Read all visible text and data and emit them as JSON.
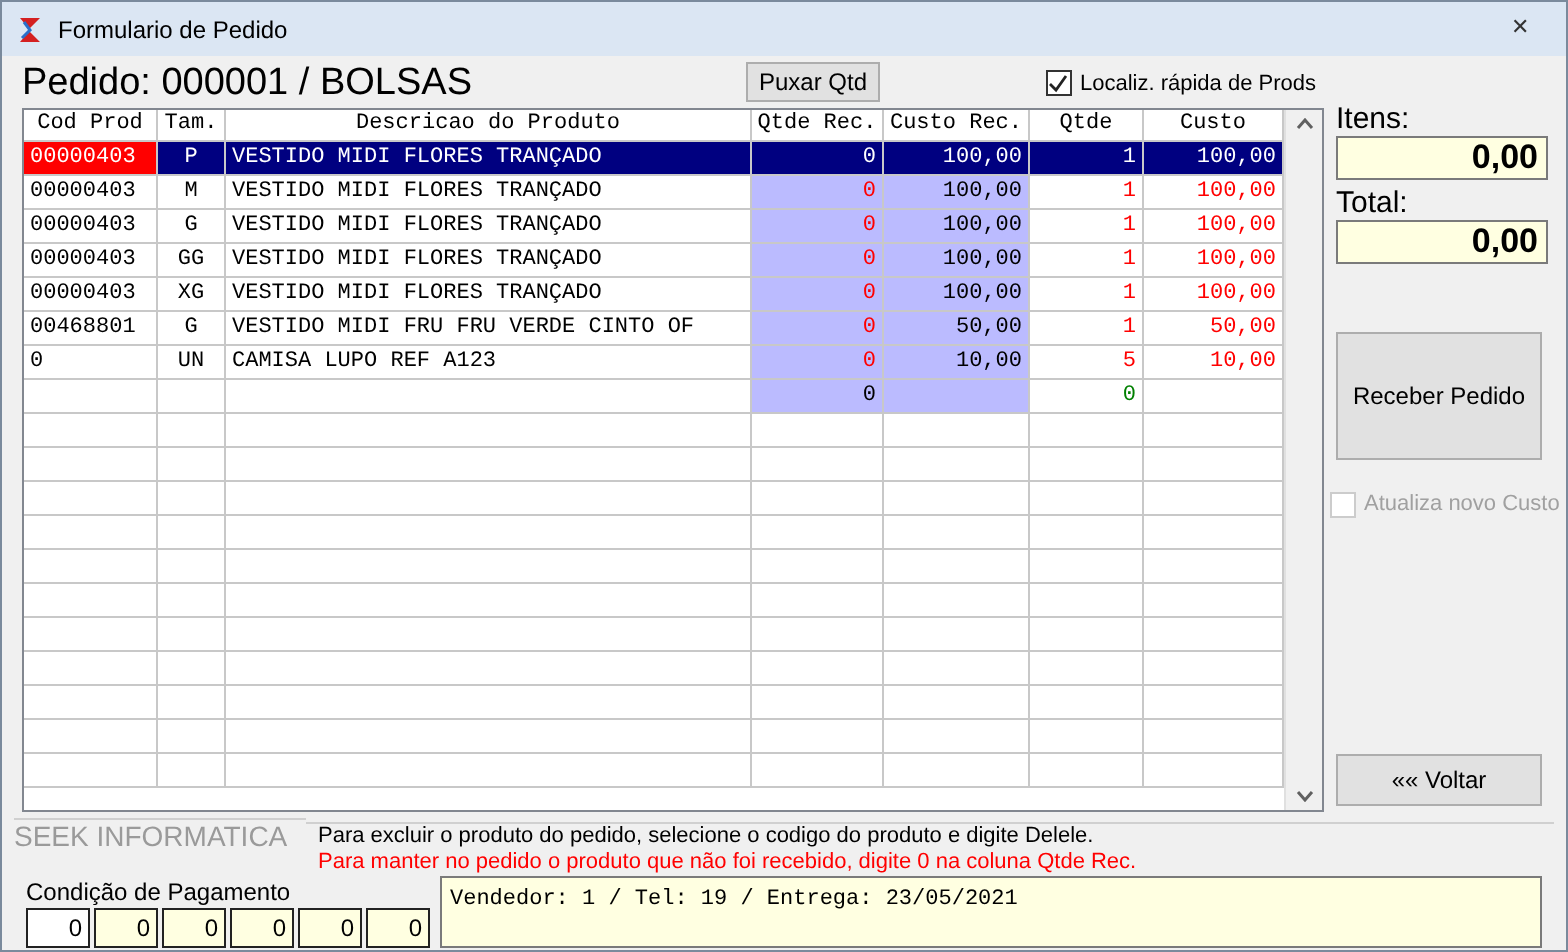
{
  "window": {
    "title": "Formulario de Pedido",
    "close": "✕"
  },
  "header": {
    "title": "Pedido: 000001 / BOLSAS",
    "pull_button": "Puxar Qtd",
    "quick_search": {
      "label": "Localiz. rápida de Prods",
      "checked": true
    }
  },
  "table": {
    "columns": [
      "Cod Prod",
      "Tam.",
      "Descricao do Produto",
      "Qtde Rec.",
      "Custo Rec.",
      "Qtde",
      "Custo"
    ],
    "rows": [
      {
        "kind": "item",
        "selected": true,
        "cells": [
          "00000403",
          "P",
          "VESTIDO MIDI FLORES TRANÇADO",
          "0",
          "100,00",
          "1",
          "100,00"
        ]
      },
      {
        "kind": "item",
        "selected": false,
        "cells": [
          "00000403",
          "M",
          "VESTIDO MIDI FLORES TRANÇADO",
          "0",
          "100,00",
          "1",
          "100,00"
        ]
      },
      {
        "kind": "item",
        "selected": false,
        "cells": [
          "00000403",
          "G",
          "VESTIDO MIDI FLORES TRANÇADO",
          "0",
          "100,00",
          "1",
          "100,00"
        ]
      },
      {
        "kind": "item",
        "selected": false,
        "cells": [
          "00000403",
          "GG",
          "VESTIDO MIDI FLORES TRANÇADO",
          "0",
          "100,00",
          "1",
          "100,00"
        ]
      },
      {
        "kind": "item",
        "selected": false,
        "cells": [
          "00000403",
          "XG",
          "VESTIDO MIDI FLORES TRANÇADO",
          "0",
          "100,00",
          "1",
          "100,00"
        ]
      },
      {
        "kind": "item",
        "selected": false,
        "cells": [
          "00468801",
          "G",
          "VESTIDO MIDI FRU FRU VERDE CINTO OF",
          "0",
          "50,00",
          "1",
          "50,00"
        ]
      },
      {
        "kind": "item",
        "selected": false,
        "cells": [
          "0",
          "UN",
          "CAMISA LUPO REF A123",
          "0",
          "10,00",
          "5",
          "10,00"
        ]
      },
      {
        "kind": "total",
        "selected": false,
        "cells": [
          "",
          "",
          "",
          "0",
          "",
          "0",
          ""
        ]
      }
    ]
  },
  "summary": {
    "items_label": "Itens:",
    "items_value": "0,00",
    "total_label": "Total:",
    "total_value": "0,00",
    "receive_button": "Receber Pedido",
    "update_cost": {
      "label": "Atualiza novo Custo",
      "checked": false,
      "disabled": true
    },
    "back_button": "«« Voltar"
  },
  "footer": {
    "group_label": "SEEK INFORMATICA",
    "hint": "Para excluir o produto do pedido, selecione o codigo do produto e digite Delele.",
    "warning": "Para manter no pedido o produto que não foi recebido, digite 0 na coluna Qtde Rec.",
    "payment_label": "Condição de Pagamento",
    "payment_fields": [
      "0",
      "0",
      "0",
      "0",
      "0",
      "0"
    ],
    "notes": "Vendedor: 1 / Tel: 19 / Entrega: 23/05/2021"
  }
}
